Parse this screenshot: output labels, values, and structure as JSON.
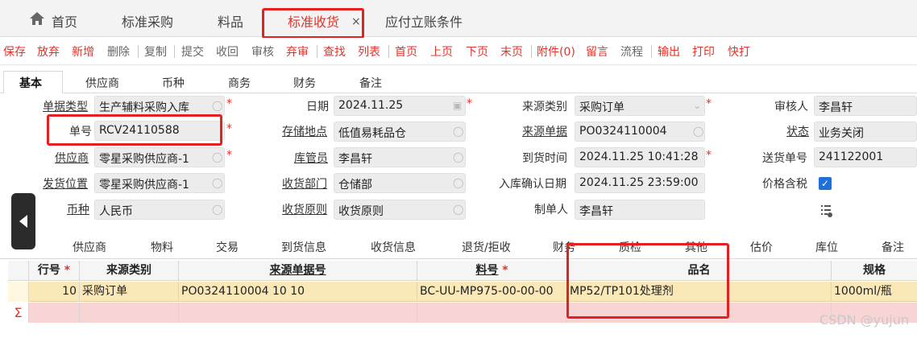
{
  "top_tabs": [
    {
      "label": "首页"
    },
    {
      "label": "标准采购"
    },
    {
      "label": "料品"
    },
    {
      "label": "标准收货"
    },
    {
      "label": "应付立账条件"
    }
  ],
  "close_glyph": "×",
  "toolbar": [
    "保存",
    "放弃",
    "新增",
    "删除",
    "复制",
    "提交",
    "收回",
    "审核",
    "弃审",
    "查找",
    "列表",
    "首页",
    "上页",
    "下页",
    "末页",
    "附件(0)",
    "留言",
    "流程",
    "输出",
    "打印",
    "快打"
  ],
  "form_tabs": [
    "基本",
    "供应商",
    "币种",
    "商务",
    "财务",
    "备注"
  ],
  "form": {
    "doc_type_label": "单据类型",
    "doc_type": "生产辅料采购入库",
    "doc_no_label": "单号",
    "doc_no": "RCV24110588",
    "supplier_label": "供应商",
    "supplier": "零星采购供应商-1",
    "ship_loc_label": "发货位置",
    "ship_loc": "零星采购供应商-1",
    "currency_label": "币种",
    "currency": "人民币",
    "date_label": "日期",
    "date": "2024.11.25",
    "storage_label": "存储地点",
    "storage": "低值易耗品仓",
    "keeper_label": "库管员",
    "keeper": "李昌轩",
    "recv_dept_label": "收货部门",
    "recv_dept": "仓储部",
    "recv_rule_label": "收货原则",
    "recv_rule": "收货原则",
    "source_type_label": "来源类别",
    "source_type": "采购订单",
    "source_doc_label": "来源单据",
    "source_doc": "PO0324110004",
    "arrival_time_label": "到货时间",
    "arrival_time": "2024.11.25 10:41:28",
    "confirm_date_label": "入库确认日期",
    "confirm_date": "2024.11.25 23:59:00",
    "creator_label": "制单人",
    "creator": "李昌轩",
    "auditor_label": "审核人",
    "auditor": "李昌轩",
    "status_label": "状态",
    "status": "业务关闭",
    "delivery_no_label": "送货单号",
    "delivery_no": "241122001",
    "price_tax_label": "价格含税"
  },
  "bottom_tabs": [
    "供应商",
    "物料",
    "交易",
    "到货信息",
    "收货信息",
    "退货/拒收",
    "财务",
    "质检",
    "其他",
    "估价",
    "库位",
    "备注"
  ],
  "grid": {
    "headers": {
      "row_no": "行号",
      "source_type": "来源类别",
      "source_doc_no": "来源单据号",
      "item_code": "料号",
      "item_name": "品名",
      "spec": "规格"
    },
    "rows": [
      {
        "row_no": "10",
        "source_type": "采购订单",
        "source_doc_no": "PO0324110004 10 10",
        "item_code": "BC-UU-MP975-00-00-00",
        "item_name": "MP52/TP101处理剂",
        "spec": "1000ml/瓶"
      }
    ],
    "sum_symbol": "Σ"
  },
  "watermark": "CSDN @yujun"
}
